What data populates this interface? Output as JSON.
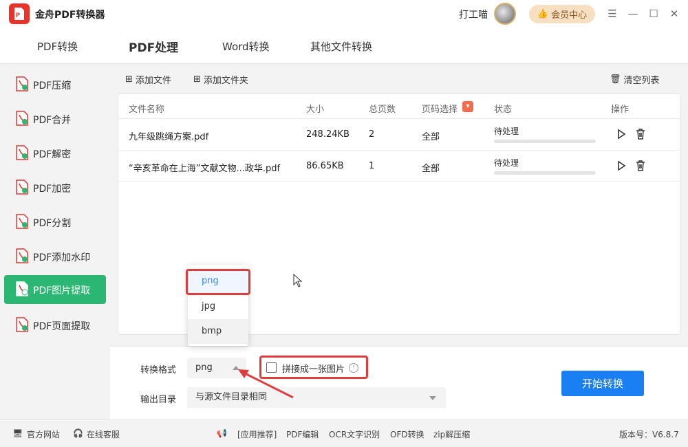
{
  "app": {
    "title": "金舟PDF转换器",
    "username": "打工喵",
    "vip_label": "会员中心"
  },
  "tabs": [
    {
      "label": "PDF转换"
    },
    {
      "label": "PDF处理"
    },
    {
      "label": "Word转换"
    },
    {
      "label": "其他文件转换"
    }
  ],
  "active_tab": "PDF处理",
  "sidebar": {
    "items": [
      {
        "label": "PDF压缩"
      },
      {
        "label": "PDF合并"
      },
      {
        "label": "PDF解密"
      },
      {
        "label": "PDF加密"
      },
      {
        "label": "PDF分割"
      },
      {
        "label": "PDF添加水印"
      },
      {
        "label": "PDF图片提取"
      },
      {
        "label": "PDF页面提取"
      }
    ],
    "active": "PDF图片提取"
  },
  "toolbar": {
    "add_file": "添加文件",
    "add_folder": "添加文件夹",
    "clear_list": "清空列表"
  },
  "table": {
    "headers": {
      "name": "文件名称",
      "size": "大小",
      "pages": "总页数",
      "page_select": "页码选择",
      "status": "状态",
      "ops": "操作"
    },
    "rows": [
      {
        "name": "九年级跳绳方案.pdf",
        "size": "248.24KB",
        "pages": "2",
        "page_select": "全部",
        "status": "待处理",
        "progress": 0
      },
      {
        "name": "“辛亥革命在上海”文献文物...政华.pdf",
        "size": "86.65KB",
        "pages": "1",
        "page_select": "全部",
        "status": "待处理",
        "progress": 0
      }
    ]
  },
  "format_dropdown": {
    "options": [
      "png",
      "jpg",
      "bmp"
    ],
    "selected": "png"
  },
  "options": {
    "format_label": "转换格式",
    "format_value": "png",
    "merge_label": "拼接成一张图片",
    "merge_checked": false,
    "output_label": "输出目录",
    "output_value": "与源文件目录相同"
  },
  "start_button": "开始转换",
  "statusbar": {
    "website": "官方网站",
    "support": "在线客服",
    "recommend": "[应用推荐]",
    "links": [
      "PDF编辑",
      "OCR文字识别",
      "OFD转换",
      "zip解压缩"
    ],
    "version": "版本号：V6.8.7"
  },
  "colors": {
    "accent_green": "#2bb673",
    "primary_blue": "#1a7ff2",
    "highlight_red": "#e03c3c",
    "logo_red": "#e9332a"
  }
}
